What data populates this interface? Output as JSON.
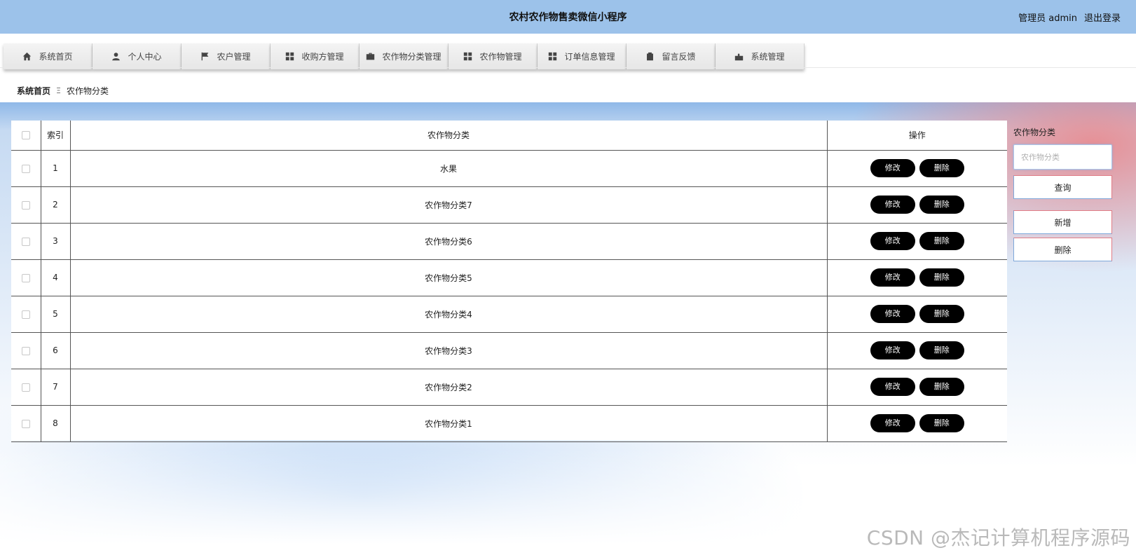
{
  "app": {
    "title": "农村农作物售卖微信小程序",
    "user_label": "管理员 admin",
    "logout_label": "退出登录"
  },
  "nav": {
    "items": [
      {
        "label": "系统首页",
        "icon": "home-icon"
      },
      {
        "label": "个人中心",
        "icon": "user-icon"
      },
      {
        "label": "农户管理",
        "icon": "flag-icon"
      },
      {
        "label": "收购方管理",
        "icon": "grid-icon"
      },
      {
        "label": "农作物分类管理",
        "icon": "briefcase-icon"
      },
      {
        "label": "农作物管理",
        "icon": "grid-icon"
      },
      {
        "label": "订单信息管理",
        "icon": "grid-icon"
      },
      {
        "label": "留言反馈",
        "icon": "clipboard-icon"
      },
      {
        "label": "系统管理",
        "icon": "puzzle-icon"
      }
    ]
  },
  "breadcrumb": {
    "home": "系统首页",
    "separator": "Ξ",
    "current": "农作物分类"
  },
  "table": {
    "headers": {
      "index": "索引",
      "category": "农作物分类",
      "action": "操作"
    },
    "edit_label": "修改",
    "delete_label": "删除",
    "rows": [
      {
        "index": "1",
        "category": "水果"
      },
      {
        "index": "2",
        "category": "农作物分类7"
      },
      {
        "index": "3",
        "category": "农作物分类6"
      },
      {
        "index": "4",
        "category": "农作物分类5"
      },
      {
        "index": "5",
        "category": "农作物分类4"
      },
      {
        "index": "6",
        "category": "农作物分类3"
      },
      {
        "index": "7",
        "category": "农作物分类2"
      },
      {
        "index": "8",
        "category": "农作物分类1"
      }
    ]
  },
  "search": {
    "label": "农作物分类",
    "placeholder": "农作物分类",
    "query_label": "查询",
    "add_label": "新增",
    "delete_label": "删除"
  },
  "watermark": "CSDN @杰记计算机程序源码",
  "colors": {
    "header_bg": "#9cc2ea",
    "pill_button": "#000000",
    "panel_border_top": "#e07c86",
    "panel_border_bottom": "#7ea8da"
  }
}
